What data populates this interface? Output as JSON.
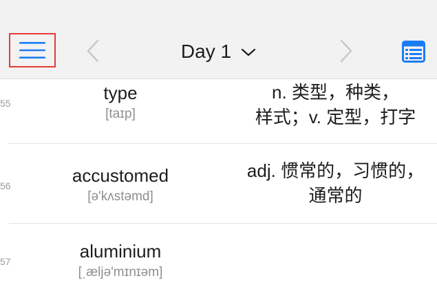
{
  "header": {
    "title": "Day 1",
    "menu_icon": "hamburger-menu-icon",
    "prev_icon": "chevron-left-icon",
    "next_icon": "chevron-right-icon",
    "dropdown_icon": "chevron-down-icon",
    "list_icon": "list-view-icon",
    "accent_color": "#1a7cf5",
    "highlight_color": "#e53935"
  },
  "words": [
    {
      "index": "55",
      "word": "type",
      "phonetic": "[taɪp]",
      "definition_lines": [
        "n. 类型，种类，",
        "样式；v. 定型，打字"
      ]
    },
    {
      "index": "56",
      "word": "accustomed",
      "phonetic": "[ə'kʌstəmd]",
      "definition_lines": [
        "adj. 惯常的，习惯的，",
        "通常的"
      ]
    },
    {
      "index": "57",
      "word": "aluminium",
      "phonetic": "[ˌæljə'mɪnɪəm]",
      "definition_lines": [
        "",
        ""
      ]
    }
  ]
}
